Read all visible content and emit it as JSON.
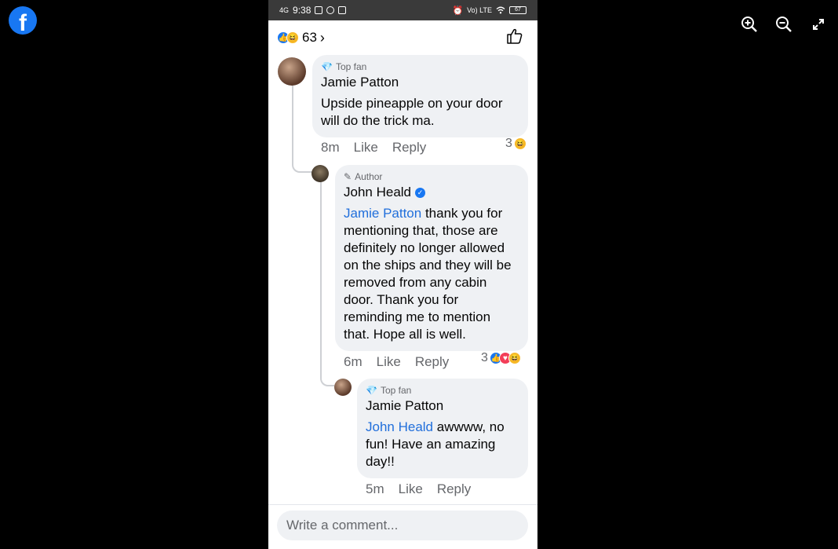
{
  "viewer": {
    "logo": "f",
    "zoom_in_icon": "zoom-in-icon",
    "zoom_out_icon": "zoom-out-icon",
    "fullscreen_icon": "fullscreen-icon"
  },
  "status_bar": {
    "network": "4G",
    "time": "9:38",
    "volte": "Vo) LTE",
    "battery": "67"
  },
  "reactions": {
    "count": "63",
    "chevron": "›"
  },
  "comments": [
    {
      "badge": "Top fan",
      "name": "Jamie Patton",
      "text": "Upside pineapple on your door will do the trick ma.",
      "time": "8m",
      "like_label": "Like",
      "reply_label": "Reply",
      "reaction_count": "3"
    },
    {
      "badge": "Author",
      "name": "John Heald",
      "mention": "Jamie Patton",
      "text": " thank you for mentioning that, those are definitely no longer allowed on the ships and they will be removed from any cabin door. Thank you for reminding me to mention that. Hope all is well.",
      "time": "6m",
      "like_label": "Like",
      "reply_label": "Reply",
      "reaction_count": "3"
    },
    {
      "badge": "Top fan",
      "name": "Jamie Patton",
      "mention": "John Heald",
      "text": " awwww, no fun! Have an amazing day!!",
      "time": "5m",
      "like_label": "Like",
      "reply_label": "Reply"
    }
  ],
  "composer": {
    "placeholder": "Write a comment..."
  },
  "colors": {
    "brand": "#1877f2",
    "mention": "#216fdb",
    "bubble": "#eff1f4"
  }
}
